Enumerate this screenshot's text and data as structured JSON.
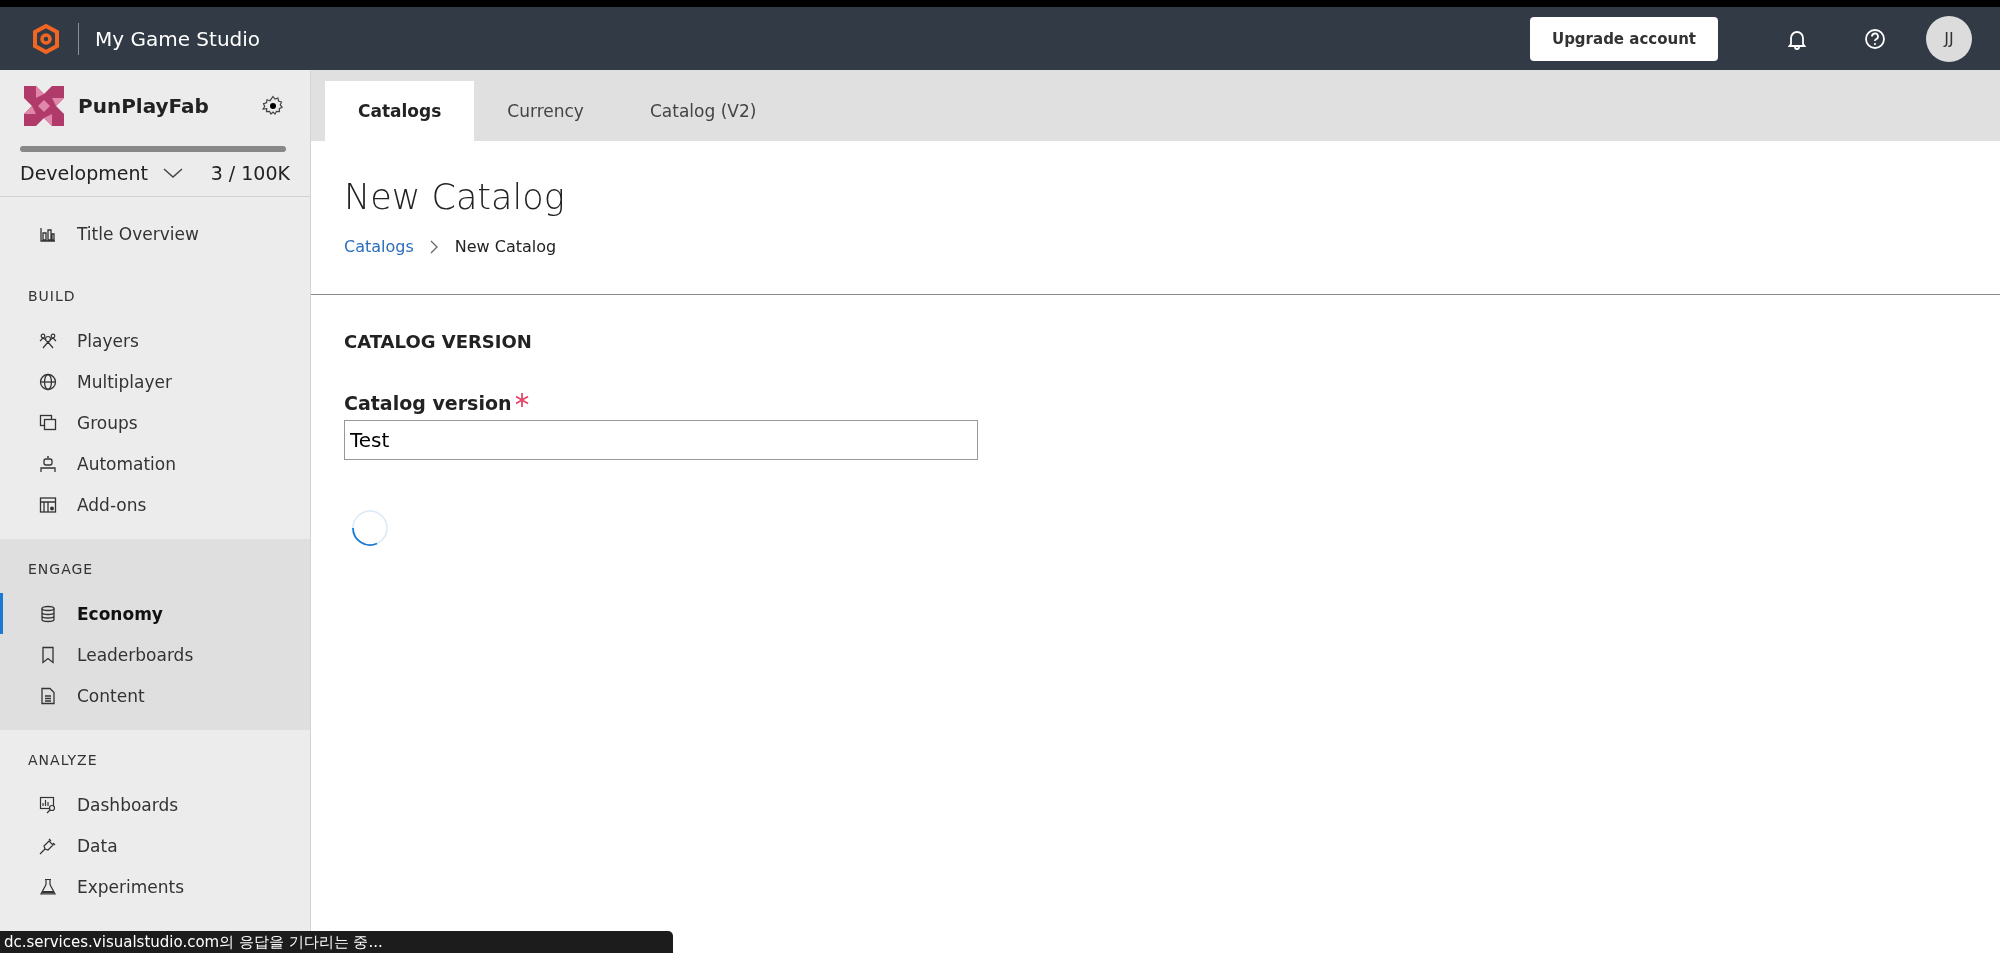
{
  "header": {
    "title": "My Game Studio",
    "upgrade_button": "Upgrade account",
    "avatar": "JJ"
  },
  "sidebar": {
    "title_name": "PunPlayFab",
    "environment": "Development",
    "usage": "3 / 100K",
    "sections": [
      {
        "items": [
          {
            "label": "Title Overview",
            "selected": false
          }
        ]
      },
      {
        "label": "BUILD",
        "items": [
          {
            "label": "Players",
            "selected": false
          },
          {
            "label": "Multiplayer",
            "selected": false
          },
          {
            "label": "Groups",
            "selected": false
          },
          {
            "label": "Automation",
            "selected": false
          },
          {
            "label": "Add-ons",
            "selected": false
          }
        ]
      },
      {
        "label": "ENGAGE",
        "items": [
          {
            "label": "Economy",
            "selected": true
          },
          {
            "label": "Leaderboards",
            "selected": false
          },
          {
            "label": "Content",
            "selected": false
          }
        ]
      },
      {
        "label": "ANALYZE",
        "items": [
          {
            "label": "Dashboards",
            "selected": false
          },
          {
            "label": "Data",
            "selected": false
          },
          {
            "label": "Experiments",
            "selected": false
          }
        ]
      }
    ]
  },
  "tabs": [
    {
      "label": "Catalogs",
      "selected": true
    },
    {
      "label": "Currency",
      "selected": false
    },
    {
      "label": "Catalog (V2)",
      "selected": false
    }
  ],
  "page": {
    "title": "New Catalog",
    "breadcrumb": [
      "Catalogs",
      "New Catalog"
    ],
    "section_heading": "CATALOG VERSION",
    "field": {
      "label": "Catalog version",
      "required": true,
      "value": "Test"
    }
  },
  "status_bar": "dc.services.visualstudio.com의 응답을 기다리는 중..."
}
